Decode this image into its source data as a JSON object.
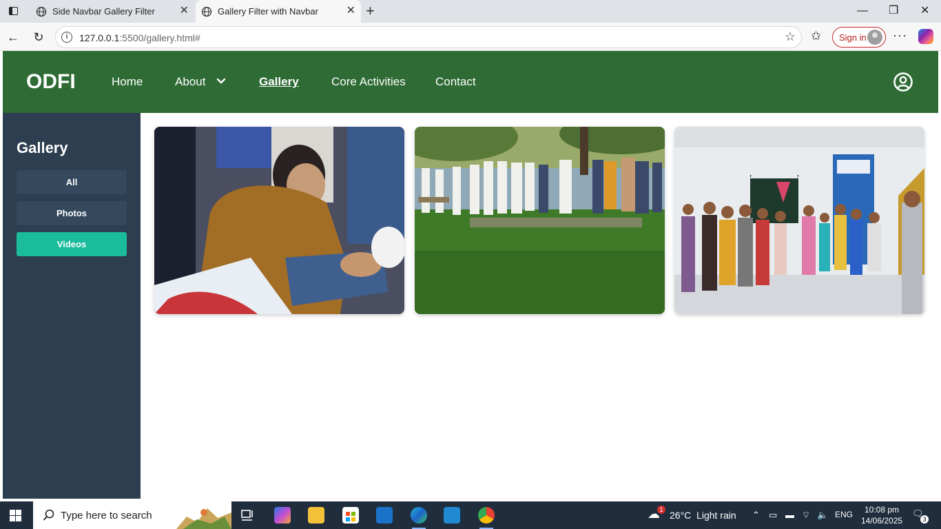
{
  "browser": {
    "tabs": [
      {
        "title": "Side Navbar Gallery Filter",
        "active": false
      },
      {
        "title": "Gallery Filter with Navbar",
        "active": true
      }
    ],
    "url_host": "127.0.0.1",
    "url_rest": ":5500/gallery.html#",
    "signin_label": "Sign in"
  },
  "site": {
    "brand": "ODFI",
    "nav": [
      {
        "label": "Home",
        "active": false
      },
      {
        "label": "About",
        "active": false,
        "has_dropdown": true
      },
      {
        "label": "Gallery",
        "active": true
      },
      {
        "label": "Core Activities",
        "active": false
      },
      {
        "label": "Contact",
        "active": false
      }
    ],
    "sidebar": {
      "title": "Gallery",
      "filters": [
        {
          "label": "All",
          "active": false
        },
        {
          "label": "Photos",
          "active": false
        },
        {
          "label": "Videos",
          "active": true
        }
      ]
    },
    "gallery_items": [
      {
        "kind": "video-thumbnail",
        "subject": "man-sorting-shoes"
      },
      {
        "kind": "video-thumbnail",
        "subject": "outdoor-prayer-gathering"
      },
      {
        "kind": "video-thumbnail",
        "subject": "indoor-group-welcome"
      }
    ],
    "colors": {
      "navbar": "#2e6b35",
      "sidebar": "#2c3e50",
      "filter_button": "#34495e",
      "filter_active": "#1abc9c"
    }
  },
  "taskbar": {
    "search_placeholder": "Type here to search",
    "weather": "26°C  Light rain",
    "weather_badge": "1",
    "language": "ENG",
    "time": "10:08 pm",
    "date": "14/06/2025",
    "notifications": "3"
  }
}
